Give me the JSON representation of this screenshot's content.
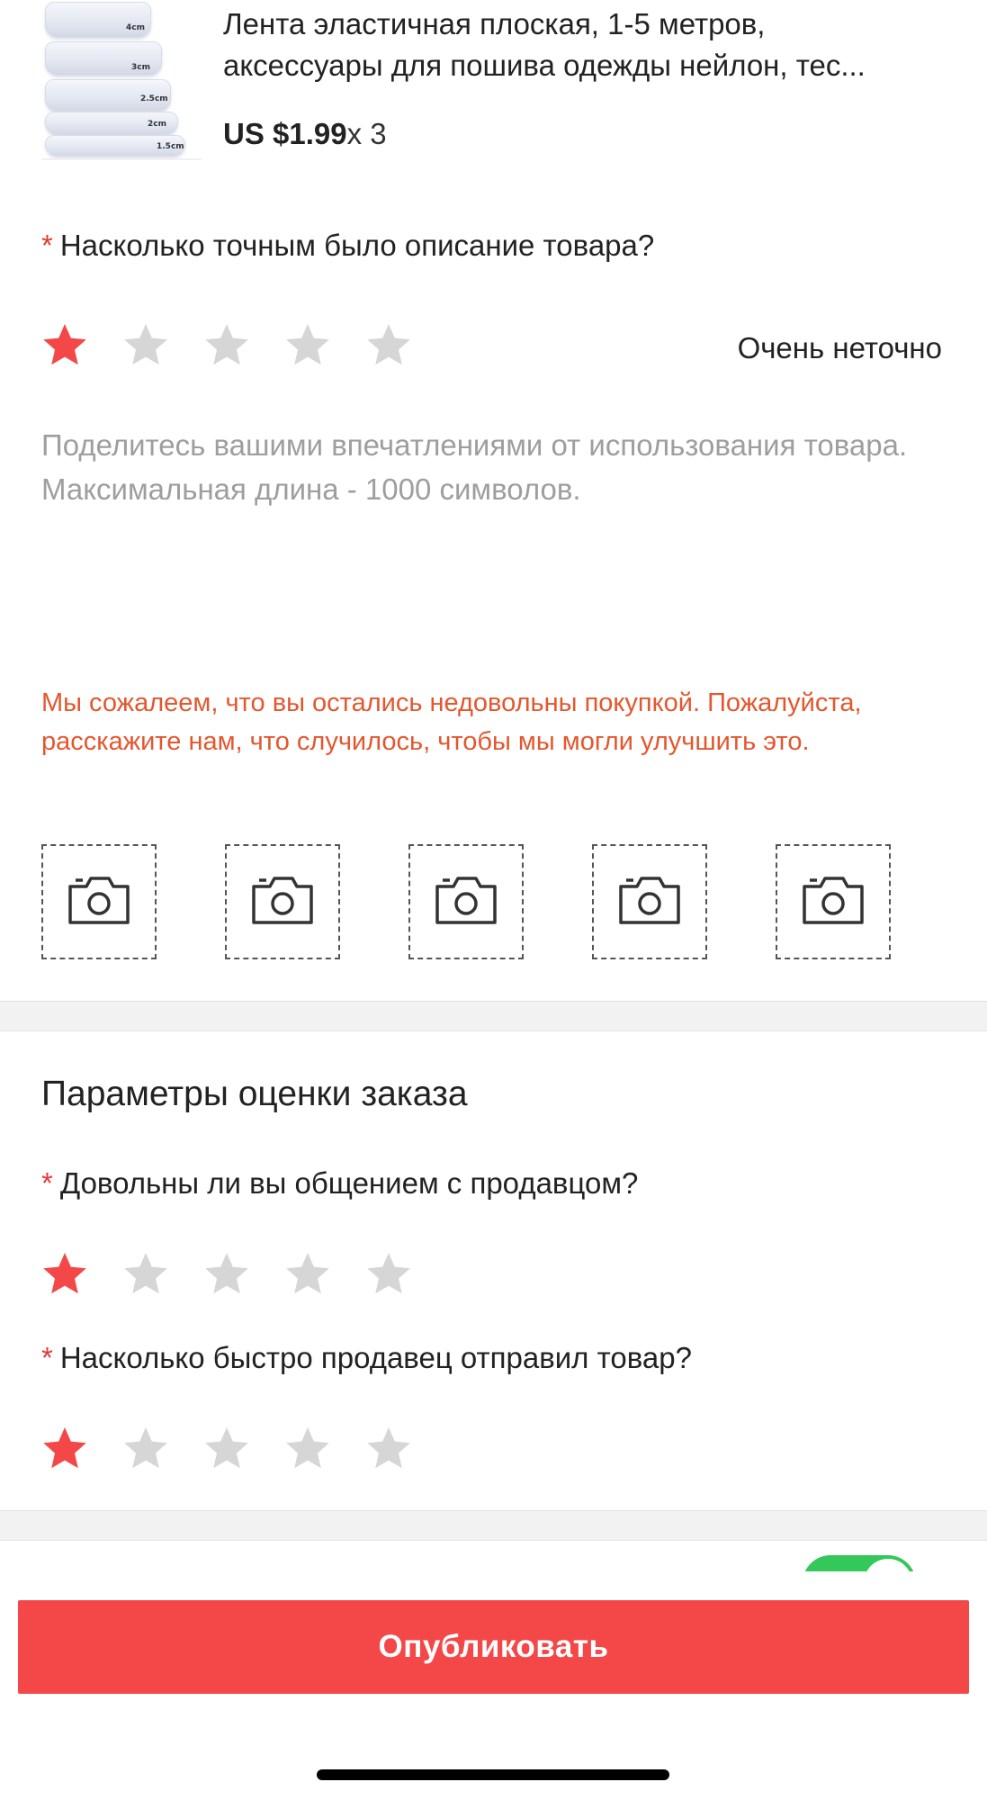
{
  "product": {
    "title_line1": "Лента эластичная плоская, 1-5 метров,",
    "title_line2": "аксессуары для пошива одежды нейлон, тес...",
    "price": "US $1.99",
    "quantity": "x 3",
    "thumbnail_labels": [
      "4cm",
      "3cm",
      "2.5cm",
      "2cm",
      "1.5cm"
    ]
  },
  "description_question": {
    "required_mark": "*",
    "text": "Насколько точным было описание товара?",
    "rating": 1,
    "max": 5,
    "rating_text": "Очень неточно"
  },
  "review": {
    "placeholder": "Поделитесь вашими впечатлениями от использования товара. Максимальная длина - 1000 символов.",
    "value": ""
  },
  "sorry_message": "Мы сожалеем, что вы остались недовольны покупкой. Пожалуйста, расскажите нам, что случилось, чтобы мы могли улучшить это.",
  "photo_slots": 5,
  "order_params": {
    "title": "Параметры оценки заказа",
    "q1": {
      "required_mark": "*",
      "text": "Довольны ли вы общением с продавцом?",
      "rating": 1,
      "max": 5
    },
    "q2": {
      "required_mark": "*",
      "text": "Насколько быстро продавец отправил товар?",
      "rating": 1,
      "max": 5
    }
  },
  "toggle": {
    "on": true
  },
  "publish_label": "Опубликовать",
  "colors": {
    "star_active": "#f44848",
    "star_inactive": "#d6d6d6",
    "accent": "#f44848",
    "warning_text": "#e4572e",
    "toggle_on": "#34c759"
  },
  "icons": {
    "star": "star-icon",
    "camera": "camera-icon"
  }
}
